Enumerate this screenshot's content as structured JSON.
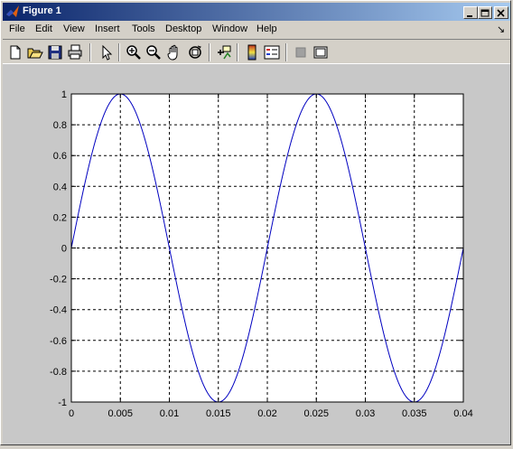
{
  "window": {
    "title": "Figure 1",
    "menu": [
      "File",
      "Edit",
      "View",
      "Insert",
      "Tools",
      "Desktop",
      "Window",
      "Help"
    ],
    "dock_arrow": "↘"
  },
  "toolbar": {
    "icons": [
      "new-file-icon",
      "open-file-icon",
      "save-icon",
      "print-icon",
      "pointer-icon",
      "zoom-in-icon",
      "zoom-out-icon",
      "pan-hand-icon",
      "rotate-3d-icon",
      "data-cursor-icon",
      "colorbar-icon",
      "legend-icon",
      "hide-plot-tools-icon",
      "show-plot-tools-icon"
    ]
  },
  "chart_data": {
    "type": "line",
    "title": "",
    "xlabel": "",
    "ylabel": "",
    "xlim": [
      0,
      0.04
    ],
    "ylim": [
      -1,
      1
    ],
    "xticks": [
      "0",
      "0.005",
      "0.01",
      "0.015",
      "0.02",
      "0.025",
      "0.03",
      "0.035",
      "0.04"
    ],
    "yticks": [
      "1",
      "0.8",
      "0.6",
      "0.4",
      "0.2",
      "0",
      "-0.2",
      "-0.4",
      "-0.6",
      "-0.8",
      "-1"
    ],
    "grid": true,
    "grid_style": "dashed",
    "series": [
      {
        "color": "#0000c0",
        "function": "sin(2*pi*50*t)",
        "x": [
          0,
          0.001,
          0.002,
          0.003,
          0.004,
          0.005,
          0.006,
          0.007,
          0.008,
          0.009,
          0.01,
          0.011,
          0.012,
          0.013,
          0.014,
          0.015,
          0.016,
          0.017,
          0.018,
          0.019,
          0.02,
          0.021,
          0.022,
          0.023,
          0.024,
          0.025,
          0.026,
          0.027,
          0.028,
          0.029,
          0.03,
          0.031,
          0.032,
          0.033,
          0.034,
          0.035,
          0.036,
          0.037,
          0.038,
          0.039,
          0.04
        ],
        "y": [
          0,
          0.309,
          0.588,
          0.809,
          0.951,
          1,
          0.951,
          0.809,
          0.588,
          0.309,
          0,
          -0.309,
          -0.588,
          -0.809,
          -0.951,
          -1,
          -0.951,
          -0.809,
          -0.588,
          -0.309,
          0,
          0.309,
          0.588,
          0.809,
          0.951,
          1,
          0.951,
          0.809,
          0.588,
          0.309,
          0,
          -0.309,
          -0.588,
          -0.809,
          -0.951,
          -1,
          -0.951,
          -0.809,
          -0.588,
          -0.309,
          0
        ]
      }
    ]
  }
}
